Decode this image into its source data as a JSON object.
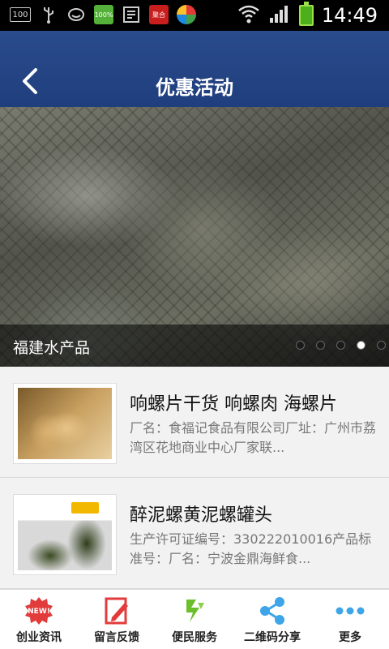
{
  "status_bar": {
    "time": "14:49",
    "left_icons": [
      "hdd-100-icon",
      "usb-icon",
      "face-icon",
      "battery-100-icon",
      "pay-icon",
      "news-icon",
      "app-store-icon"
    ],
    "hdd_label": "100",
    "battery_small_label": "100%",
    "pay_label": "聚合",
    "right_icons": [
      "wifi-icon",
      "signal-icon",
      "battery-icon"
    ]
  },
  "header": {
    "title": "优惠活动",
    "back_icon": "chevron-left-icon",
    "background": "#24457f"
  },
  "banner": {
    "caption": "福建水产品",
    "dots": [
      false,
      false,
      false,
      true,
      false
    ]
  },
  "list": [
    {
      "title": "响螺片干货 响螺肉 海螺片",
      "description": "厂名：食福记食品有限公司厂址：广州市荔湾区花地商业中心厂家联..."
    },
    {
      "title": "醉泥螺黄泥螺罐头",
      "description": "生产许可证编号：330222010016产品标准号：厂名：宁波金鼎海鲜食..."
    }
  ],
  "bottom_nav": [
    {
      "label": "创业资讯",
      "icon": "new-badge-icon"
    },
    {
      "label": "留言反馈",
      "icon": "pen-note-icon"
    },
    {
      "label": "便民服务",
      "icon": "service-icon"
    },
    {
      "label": "二维码分享",
      "icon": "share-icon"
    },
    {
      "label": "更多",
      "icon": "more-dots-icon"
    }
  ],
  "colors": {
    "header_blue": "#24457f",
    "nav_red": "#e23b3b",
    "nav_green": "#6abf2b",
    "nav_blue": "#3da5e8"
  }
}
